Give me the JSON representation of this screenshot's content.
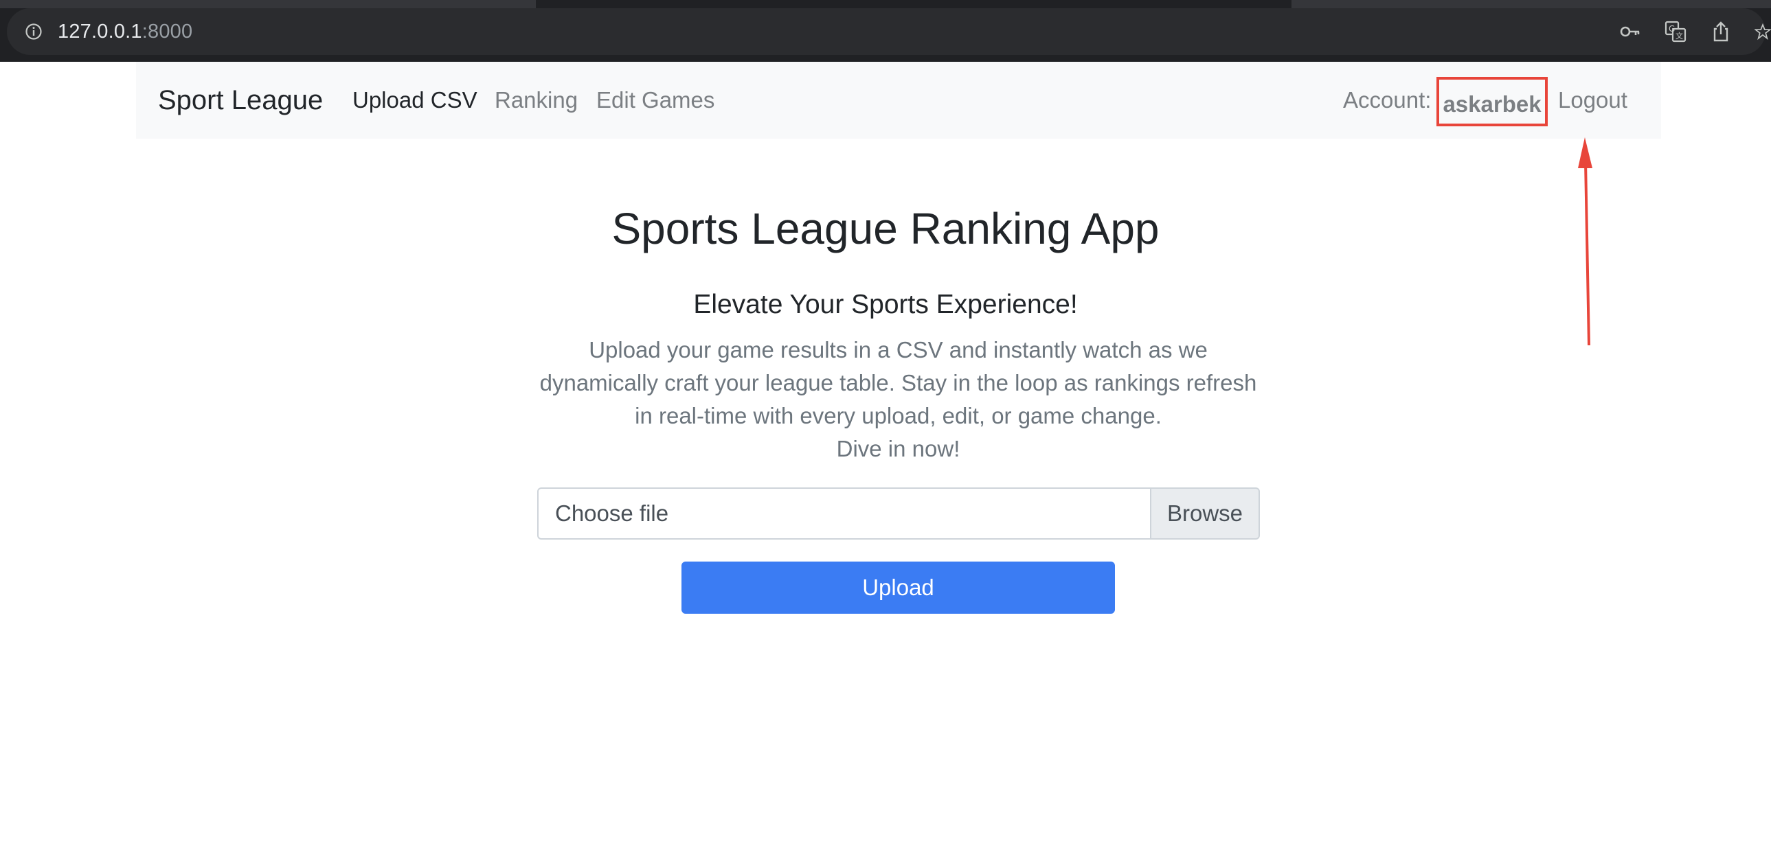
{
  "browser": {
    "url_host": "127.0.0.1",
    "url_port": ":8000",
    "icons": [
      "info-icon",
      "key-icon",
      "translate-icon",
      "share-icon",
      "star-icon"
    ]
  },
  "navbar": {
    "brand": "Sport League",
    "links": [
      {
        "label": "Upload CSV",
        "active": true
      },
      {
        "label": "Ranking",
        "active": false
      },
      {
        "label": "Edit Games",
        "active": false
      }
    ],
    "account_label": "Account:",
    "account_user": "askarbek",
    "logout": "Logout"
  },
  "main": {
    "title": "Sports League Ranking App",
    "subtitle": "Elevate Your Sports Experience!",
    "lead_lines": [
      "Upload your game results in a CSV and instantly watch as we",
      "dynamically craft your league table. Stay in the loop as rankings refresh",
      "in real-time with every upload, edit, or game change.",
      "Dive in now!"
    ],
    "file_placeholder": "Choose file",
    "browse_label": "Browse",
    "upload_label": "Upload"
  },
  "colors": {
    "primary": "#3b7cf3",
    "annotation": "#e8453a",
    "navbar_bg": "#f8f9fa"
  }
}
